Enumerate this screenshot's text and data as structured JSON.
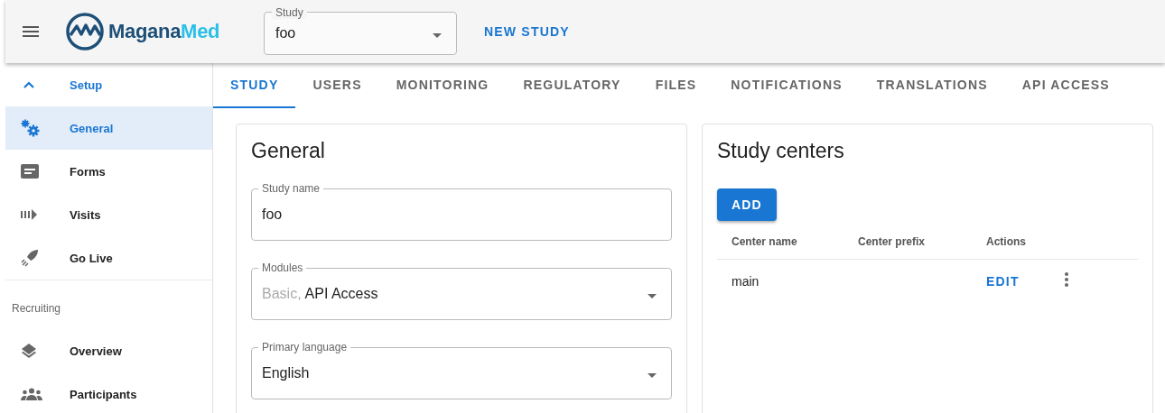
{
  "header": {
    "logo": {
      "part1": "Magana",
      "part2": "Med"
    },
    "study_select": {
      "label": "Study",
      "value": "foo"
    },
    "new_study": "NEW STUDY"
  },
  "sidebar": {
    "sections": [
      {
        "title": "Setup",
        "expanded": true,
        "items": [
          {
            "label": "General",
            "kind": "gears",
            "selected": true
          },
          {
            "label": "Forms",
            "kind": "form",
            "selected": false
          },
          {
            "label": "Visits",
            "kind": "visits",
            "selected": false
          },
          {
            "label": "Go Live",
            "kind": "rocket",
            "selected": false
          }
        ]
      },
      {
        "title": "Recruiting",
        "items": [
          {
            "label": "Overview",
            "kind": "layers",
            "selected": false
          },
          {
            "label": "Participants",
            "kind": "people",
            "selected": false
          }
        ]
      }
    ]
  },
  "tabs": [
    {
      "label": "STUDY",
      "selected": true
    },
    {
      "label": "USERS",
      "selected": false
    },
    {
      "label": "MONITORING",
      "selected": false
    },
    {
      "label": "REGULATORY",
      "selected": false
    },
    {
      "label": "FILES",
      "selected": false
    },
    {
      "label": "NOTIFICATIONS",
      "selected": false
    },
    {
      "label": "TRANSLATIONS",
      "selected": false
    },
    {
      "label": "API ACCESS",
      "selected": false
    }
  ],
  "general": {
    "title": "General",
    "fields": [
      {
        "kind": "text",
        "label": "Study name",
        "value": "foo"
      },
      {
        "kind": "multiselect",
        "label": "Modules",
        "values": [
          {
            "label": "Basic,",
            "disabled": true
          },
          {
            "label": "API Access",
            "disabled": false
          }
        ]
      },
      {
        "kind": "select",
        "label": "Primary language",
        "value": "English"
      }
    ]
  },
  "study_centers": {
    "title": "Study centers",
    "add_button": "ADD",
    "columns": [
      "Center name",
      "Center prefix",
      "Actions"
    ],
    "rows": [
      {
        "name": "main",
        "action": "EDIT"
      }
    ]
  }
}
